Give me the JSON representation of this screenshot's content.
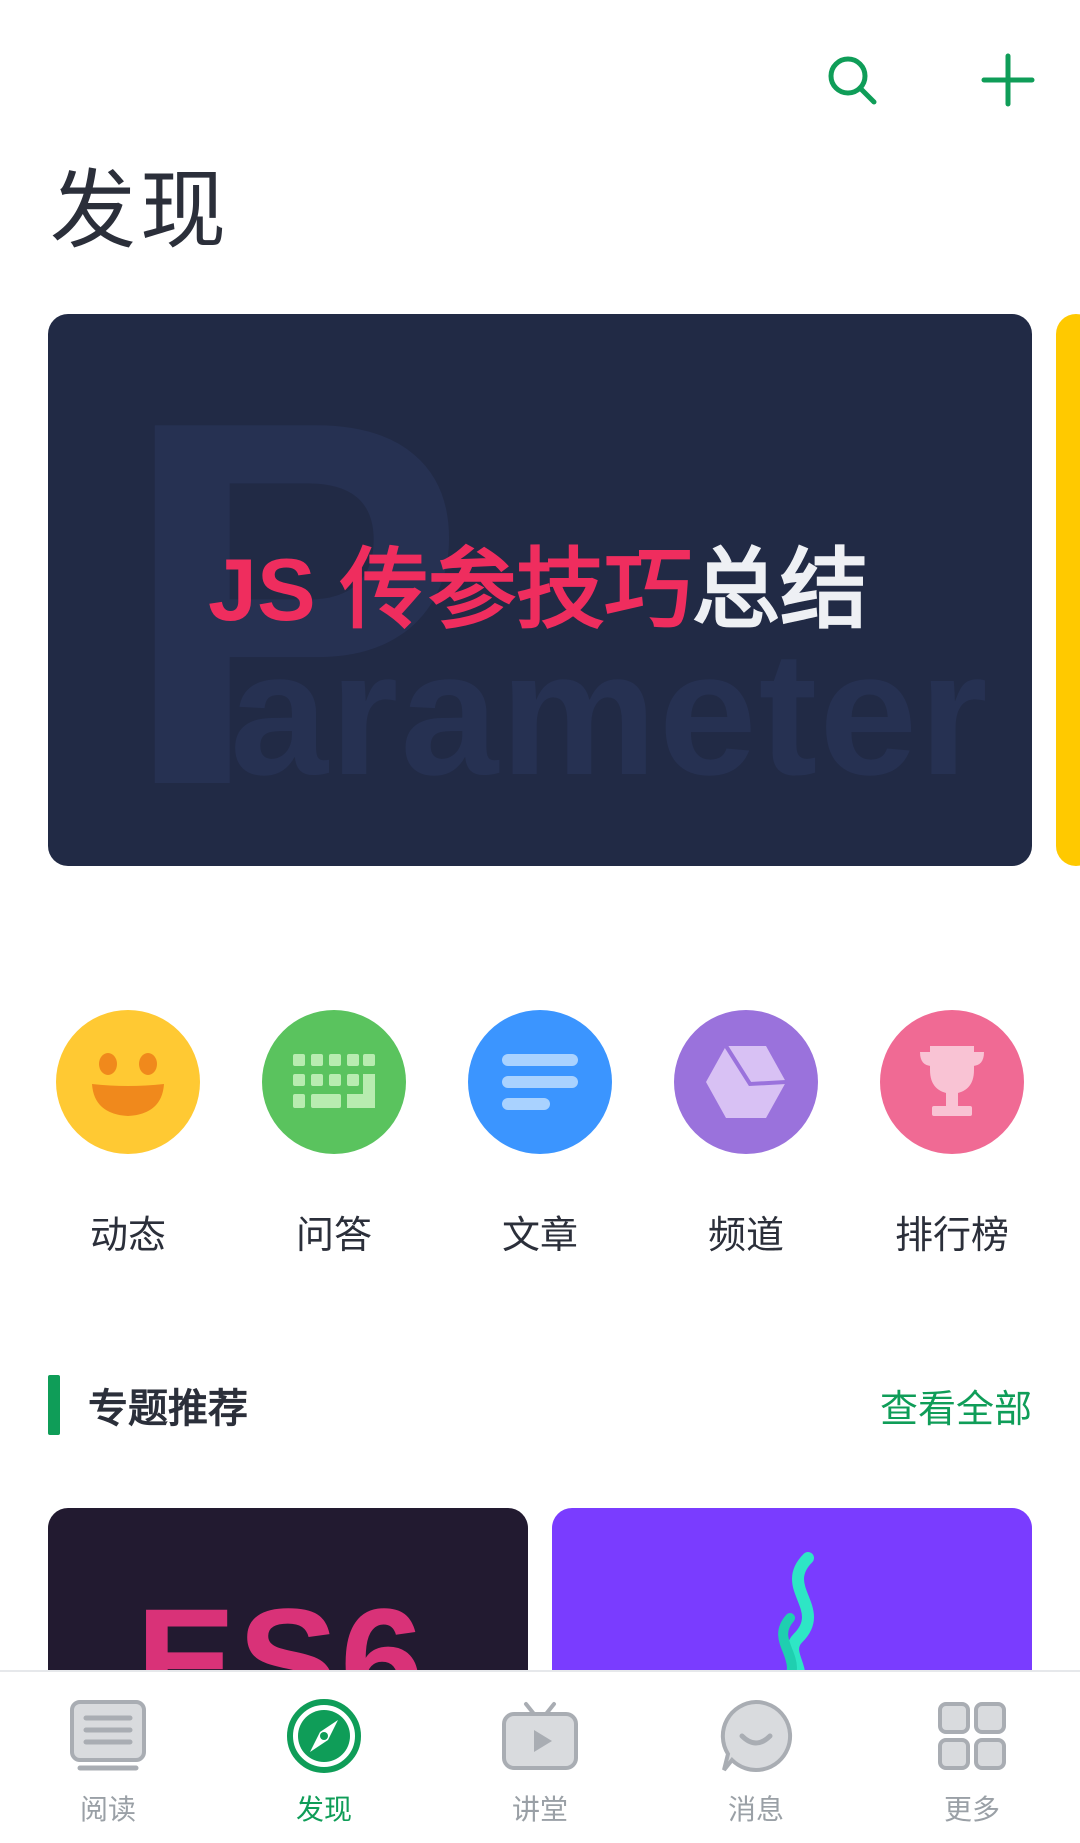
{
  "header": {
    "title": "发现",
    "actions": [
      {
        "icon": "search-icon"
      },
      {
        "icon": "plus-icon"
      }
    ]
  },
  "banner": {
    "watermark_letter": "P",
    "watermark_word": "arameter",
    "title_accent": "JS 传参技巧",
    "title_plain": "总结",
    "accent_color": "#ef2d5e",
    "background": "#212a45"
  },
  "features": [
    {
      "label": "动态",
      "icon": "smile-icon",
      "color": "#ffc933"
    },
    {
      "label": "问答",
      "icon": "keyboard-icon",
      "color": "#5ac35e"
    },
    {
      "label": "文章",
      "icon": "article-icon",
      "color": "#3b95ff"
    },
    {
      "label": "频道",
      "icon": "cube-icon",
      "color": "#9a72dc"
    },
    {
      "label": "排行榜",
      "icon": "trophy-icon",
      "color": "#f06a94"
    }
  ],
  "section": {
    "title": "专题推荐",
    "link": "查看全部"
  },
  "topics": [
    {
      "text": "ES6",
      "icon": "es6-logo"
    },
    {
      "text": "",
      "icon": "java-flame-logo"
    }
  ],
  "bottom_nav": [
    {
      "label": "阅读",
      "icon": "book-icon",
      "active": false
    },
    {
      "label": "发现",
      "icon": "compass-icon",
      "active": true
    },
    {
      "label": "讲堂",
      "icon": "tv-play-icon",
      "active": false
    },
    {
      "label": "消息",
      "icon": "chat-bubble-icon",
      "active": false
    },
    {
      "label": "更多",
      "icon": "grid-icon",
      "active": false
    }
  ],
  "colors": {
    "brand": "#0f9d58",
    "text": "#2b2f3a",
    "inactive": "#9aa0a6"
  }
}
